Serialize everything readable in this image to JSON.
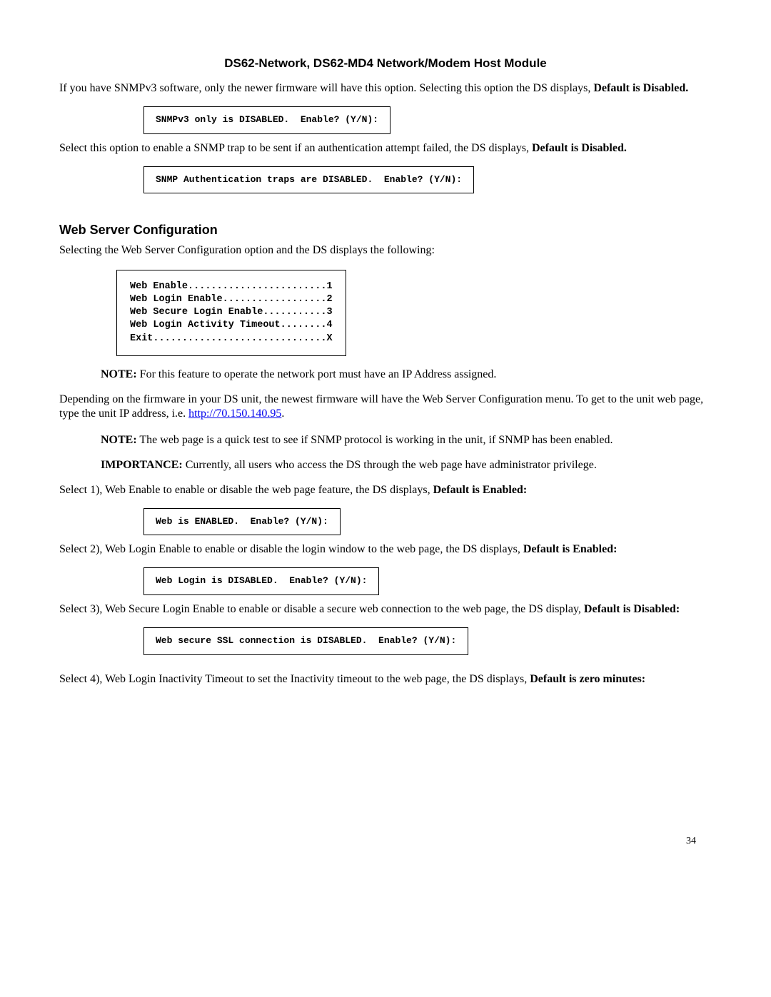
{
  "title": "DS62-Network, DS62-MD4 Network/Modem Host Module",
  "para1a": "If you have SNMPv3 software, only the newer firmware will have this option. Selecting this option the DS displays, ",
  "para1b": "Default is Disabled.",
  "box1": "SNMPv3 only is DISABLED.  Enable? (Y/N):",
  "para2a": "Select this option to enable a SNMP trap to be sent if an authentication attempt failed, the DS displays, ",
  "para2b": "Default is Disabled.",
  "box2": "SNMP Authentication traps are DISABLED.  Enable? (Y/N):",
  "sectionHeading": "Web Server Configuration",
  "para3": "Selecting the Web Server Configuration option and the DS displays the following:",
  "menuBox": "Web Enable........................1\nWeb Login Enable..................2\nWeb Secure Login Enable...........3\nWeb Login Activity Timeout........4\nExit..............................X",
  "note1Label": "NOTE:",
  "note1Text": " For this feature to operate the network port must have an IP Address assigned.",
  "para4a": "Depending on the firmware in your DS unit, the newest firmware will have the Web Server Configuration menu. To get to the unit web page, type the unit IP address, i.e. ",
  "linkText": "http://70.150.140.95",
  "linkHref": "http://70.150.140.95",
  "para4b": ".",
  "note2Label": "NOTE:",
  "note2Text": " The web page is a quick test to see if SNMP protocol is working in the unit, if SNMP has been enabled.",
  "importanceLabel": "IMPORTANCE:",
  "importanceText": " Currently, all users who access the DS through the web page have administrator privilege.",
  "para5a": "Select 1), Web Enable to enable or disable the web page feature, the DS displays, ",
  "para5b": "Default is Enabled:",
  "box3": "Web is ENABLED.  Enable? (Y/N):",
  "para6a": "Select 2), Web Login Enable to enable or disable the login window to the web page, the DS displays, ",
  "para6b": "Default is Enabled:",
  "box4": "Web Login is DISABLED.  Enable? (Y/N):",
  "para7a": "Select 3), Web Secure Login Enable to enable or disable a secure web connection to the web page, the DS display, ",
  "para7b": "Default is Disabled:",
  "box5": "Web secure SSL connection is DISABLED.  Enable? (Y/N):",
  "para8a": "Select 4), Web Login Inactivity Timeout to set the Inactivity timeout to the web page, the DS displays, ",
  "para8b": "Default is zero minutes:",
  "pageNumber": "34"
}
